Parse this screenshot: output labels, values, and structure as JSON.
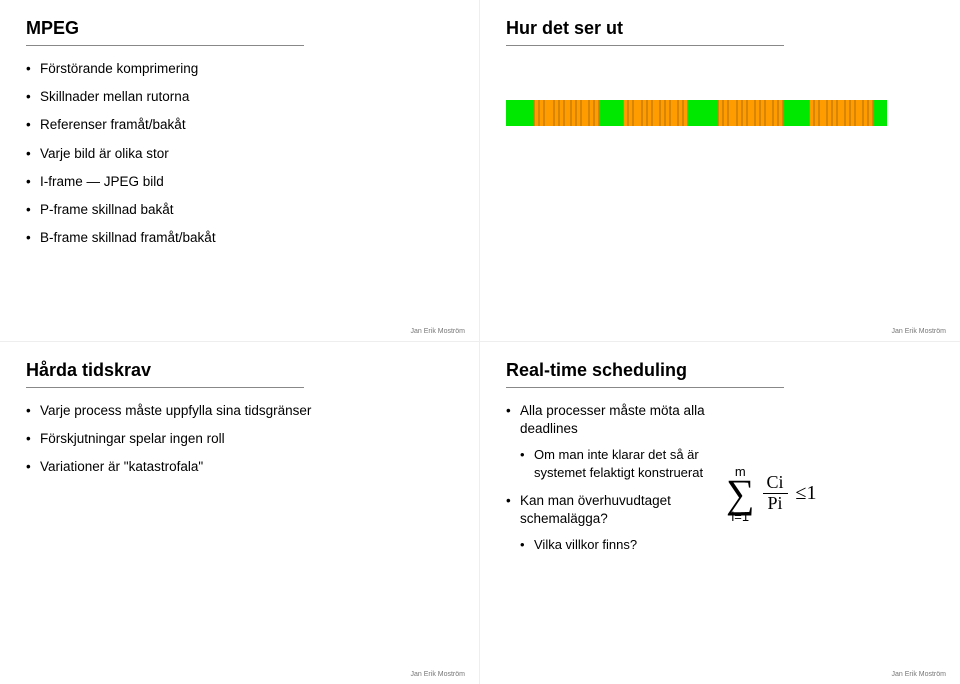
{
  "footer": "Jan Erik Moström",
  "slide1": {
    "title": "MPEG",
    "items": [
      "Förstörande komprimering",
      "Skillnader mellan rutorna",
      "Referenser framåt/bakåt",
      "Varje bild är olika stor",
      "I-frame — JPEG bild",
      "P-frame skillnad bakåt",
      "B-frame skillnad framåt/bakåt"
    ]
  },
  "slide2": {
    "title": "Hur det ser ut"
  },
  "slide3": {
    "title": "Hårda tidskrav",
    "items": [
      "Varje process måste uppfylla sina tidsgränser",
      "Förskjutningar spelar ingen roll",
      "Variationer är \"katastrofala\""
    ]
  },
  "slide4": {
    "title": "Real-time scheduling",
    "b1": "Alla processer måste möta alla deadlines",
    "b1s1": "Om man inte klarar det så är systemet felaktigt konstruerat",
    "b2": "Kan man överhuvudtaget schemalägga?",
    "b2s1": "Vilka villkor finns?",
    "formula": {
      "top": "m",
      "bot": "i=1",
      "num": "Ci",
      "den": "Pi",
      "rhs": "≤1"
    }
  }
}
